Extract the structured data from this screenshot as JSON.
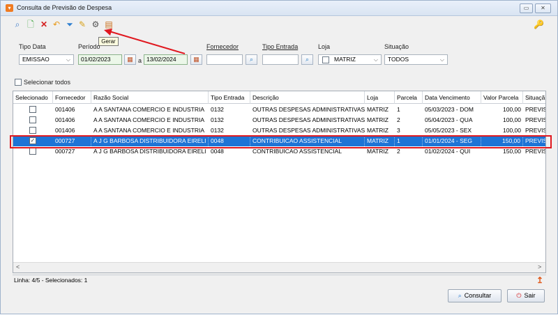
{
  "window": {
    "title": "Consulta de Previsão de Despesa",
    "min_label": "▭",
    "close_label": "✕"
  },
  "toolbar": {
    "tooltip": "Gerar"
  },
  "filters": {
    "tipo_data_label": "Tipo Data",
    "tipo_data_value": "EMISSAO",
    "periodo_label": "Período",
    "date_start": "01/02/2023",
    "date_sep": "a",
    "date_end": "13/02/2024",
    "fornecedor_label": "Fornecedor",
    "fornecedor_value": "",
    "tipo_entrada_label": "Tipo Entrada",
    "tipo_entrada_value": "",
    "loja_label": "Loja",
    "loja_value": "MATRIZ",
    "situacao_label": "Situação",
    "situacao_value": "TODOS",
    "select_all_label": "Selecionar todos"
  },
  "grid": {
    "columns": [
      "Selecionado",
      "Fornecedor",
      "Razão Social",
      "Tipo Entrada",
      "Descrição",
      "Loja",
      "Parcela",
      "Data Vencimento",
      "Valor Parcela",
      "Situaçã"
    ],
    "rows": [
      {
        "checked": false,
        "fornecedor": "001406",
        "razao": "A A SANTANA COMERCIO E INDUSTRIA",
        "tipo": "0132",
        "descricao": "OUTRAS DESPESAS ADMINISTRATIVAS",
        "loja": "MATRIZ",
        "parcela": "1",
        "venc": "05/03/2023 - DOM",
        "valor": "100,00",
        "situacao": "PREVIST"
      },
      {
        "checked": false,
        "fornecedor": "001406",
        "razao": "A A SANTANA COMERCIO E INDUSTRIA",
        "tipo": "0132",
        "descricao": "OUTRAS DESPESAS ADMINISTRATIVAS",
        "loja": "MATRIZ",
        "parcela": "2",
        "venc": "05/04/2023 - QUA",
        "valor": "100,00",
        "situacao": "PREVIST"
      },
      {
        "checked": false,
        "fornecedor": "001406",
        "razao": "A A SANTANA COMERCIO E INDUSTRIA",
        "tipo": "0132",
        "descricao": "OUTRAS DESPESAS ADMINISTRATIVAS",
        "loja": "MATRIZ",
        "parcela": "3",
        "venc": "05/05/2023 - SEX",
        "valor": "100,00",
        "situacao": "PREVIST"
      },
      {
        "checked": true,
        "fornecedor": "000727",
        "razao": "A J G BARBOSA DISTRIBUIDORA EIRELI",
        "tipo": "0048",
        "descricao": "CONTRIBUICAO ASSISTENCIAL",
        "loja": "MATRIZ",
        "parcela": "1",
        "venc": "01/01/2024 - SEG",
        "valor": "150,00",
        "situacao": "PREVIST"
      },
      {
        "checked": false,
        "fornecedor": "000727",
        "razao": "A J G BARBOSA DISTRIBUIDORA EIRELI",
        "tipo": "0048",
        "descricao": "CONTRIBUICAO ASSISTENCIAL",
        "loja": "MATRIZ",
        "parcela": "2",
        "venc": "01/02/2024 - QUI",
        "valor": "150,00",
        "situacao": "PREVIST"
      }
    ]
  },
  "status": {
    "text": "Linha: 4/5 - Selecionados: 1"
  },
  "footer": {
    "consultar_label": "Consultar",
    "sair_label": "Sair"
  },
  "colors": {
    "selection": "#1e74d6",
    "highlight_border": "#e0181f",
    "title_icon": "#f07b22"
  }
}
